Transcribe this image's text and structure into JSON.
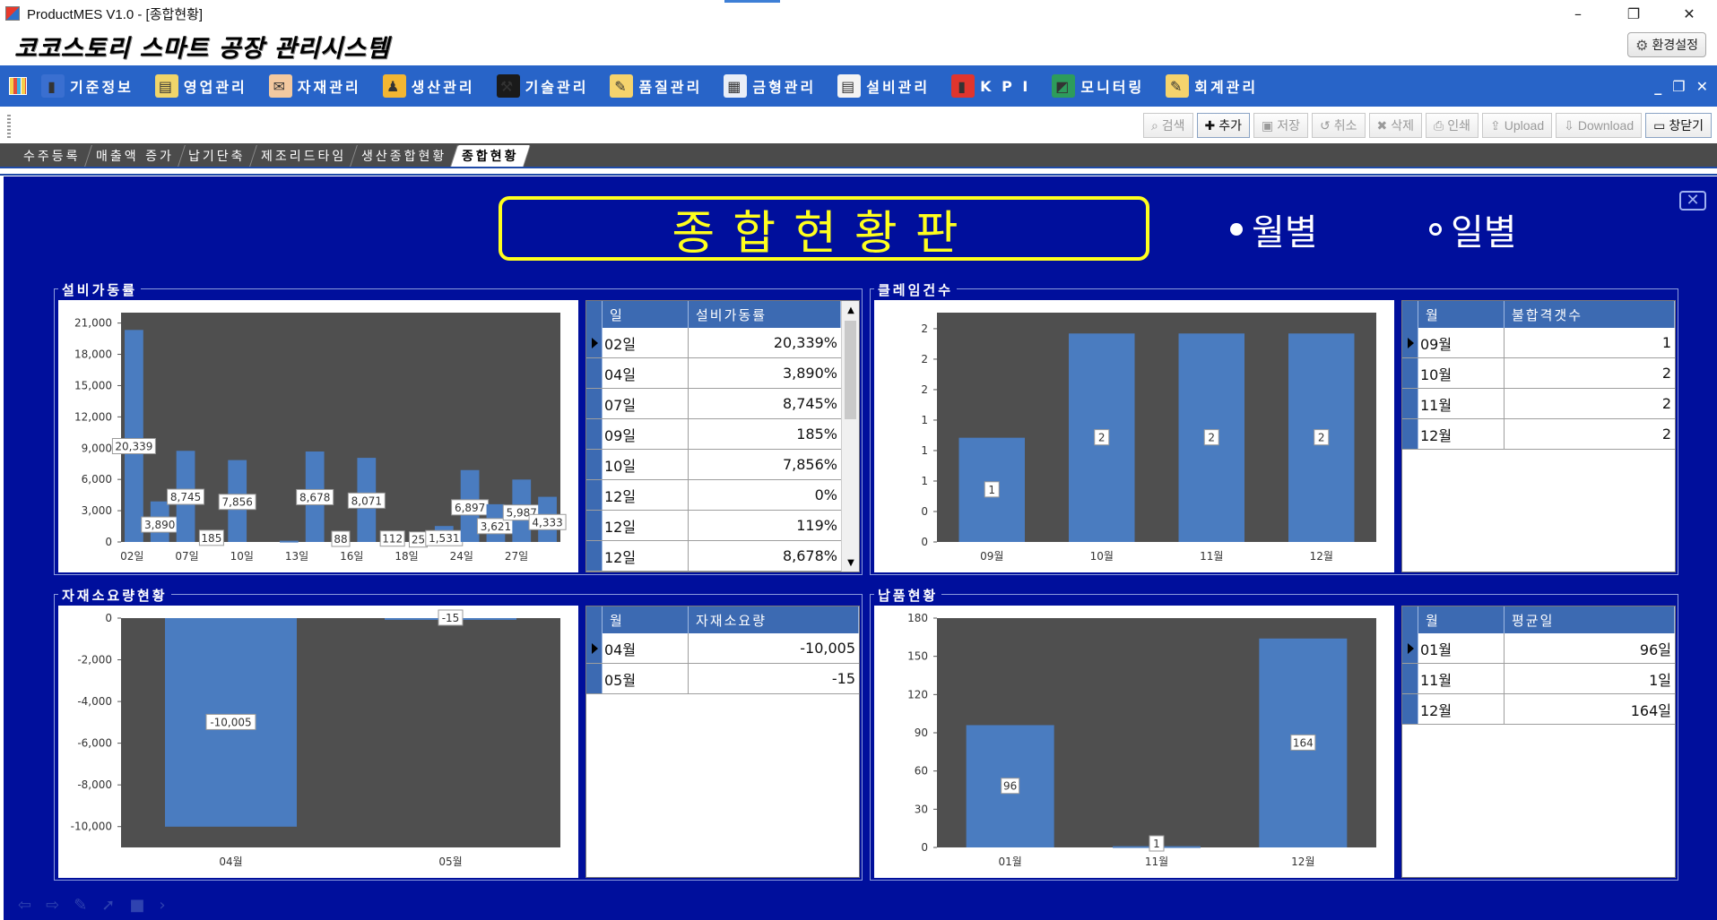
{
  "window": {
    "title": "ProductMES V1.0 - [종합현황]",
    "minimize": "–",
    "maximize": "❐",
    "close": "✕"
  },
  "app": {
    "name": "코코스토리 스마트 공장 관리시스템",
    "settings_label": "환경설정",
    "settings_icon": "gear-icon"
  },
  "menu": {
    "items": [
      {
        "label": "기준정보",
        "icon": "book-icon",
        "color": "#3a6fd0"
      },
      {
        "label": "영업관리",
        "icon": "clipboard-icon",
        "color": "#f0d56a"
      },
      {
        "label": "자재관리",
        "icon": "inbox-icon",
        "color": "#f3c9a0"
      },
      {
        "label": "생산관리",
        "icon": "workers-icon",
        "color": "#f2b632"
      },
      {
        "label": "기술관리",
        "icon": "tools-icon",
        "color": "#1a1a1a"
      },
      {
        "label": "품질관리",
        "icon": "notepad-icon",
        "color": "#f5d36d"
      },
      {
        "label": "금형관리",
        "icon": "calculator-icon",
        "color": "#e9eef7"
      },
      {
        "label": "설비관리",
        "icon": "document-icon",
        "color": "#f3f3f3"
      },
      {
        "label": "K P I",
        "icon": "bar-chart-icon",
        "color": "#e0352d"
      },
      {
        "label": "모니터링",
        "icon": "monitor-icon",
        "color": "#2d9c5b"
      },
      {
        "label": "회계관리",
        "icon": "notepad-icon",
        "color": "#f5d36d"
      }
    ],
    "win_controls": [
      "_",
      "❐",
      "✕"
    ]
  },
  "toolbar": {
    "buttons": [
      {
        "label": "검색",
        "icon": "search-icon"
      },
      {
        "label": "추가",
        "icon": "add-icon",
        "active": true
      },
      {
        "label": "저장",
        "icon": "save-icon"
      },
      {
        "label": "취소",
        "icon": "undo-icon"
      },
      {
        "label": "삭제",
        "icon": "delete-icon"
      },
      {
        "label": "인쇄",
        "icon": "print-icon"
      },
      {
        "label": "Upload",
        "icon": "upload-icon"
      },
      {
        "label": "Download",
        "icon": "download-icon"
      },
      {
        "label": "창닫기",
        "icon": "close-window-icon",
        "active": true
      }
    ]
  },
  "tabs": [
    "수주등록",
    "매출액 증가",
    "납기단축",
    "제조리드타임",
    "생산종합현황",
    "종합현황"
  ],
  "active_tab": 5,
  "board": {
    "title": "종합현황판",
    "radio_monthly": "월별",
    "radio_daily": "일별",
    "close_icon": "close-box-icon"
  },
  "panels": {
    "equipment": {
      "label": "설비가동률",
      "grid": {
        "headers": [
          "일",
          "설비가동률"
        ],
        "rows": [
          [
            "02일",
            "20,339%"
          ],
          [
            "04일",
            "3,890%"
          ],
          [
            "07일",
            "8,745%"
          ],
          [
            "09일",
            "185%"
          ],
          [
            "10일",
            "7,856%"
          ],
          [
            "12일",
            "0%"
          ],
          [
            "12일",
            "119%"
          ],
          [
            "12일",
            "8,678%"
          ]
        ]
      }
    },
    "claims": {
      "label": "클레임건수",
      "grid": {
        "headers": [
          "월",
          "불합격갯수"
        ],
        "rows": [
          [
            "09월",
            "1"
          ],
          [
            "10월",
            "2"
          ],
          [
            "11월",
            "2"
          ],
          [
            "12월",
            "2"
          ]
        ]
      }
    },
    "material": {
      "label": "자재소요량현황",
      "grid": {
        "headers": [
          "월",
          "자재소요량"
        ],
        "rows": [
          [
            "04월",
            "-10,005"
          ],
          [
            "05월",
            "-15"
          ]
        ]
      }
    },
    "delivery": {
      "label": "납품현황",
      "grid": {
        "headers": [
          "월",
          "평균일"
        ],
        "rows": [
          [
            "01월",
            "96일"
          ],
          [
            "11월",
            "1일"
          ],
          [
            "12월",
            "164일"
          ]
        ]
      }
    }
  },
  "chart_data": [
    {
      "type": "bar",
      "categories": [
        "02일",
        "04일",
        "07일",
        "09일",
        "10일",
        "12일",
        "12일",
        "12일",
        "13일",
        "16일",
        "16일",
        "18일",
        "18일",
        "24일",
        "24일",
        "24일",
        "27일"
      ],
      "values": [
        20339,
        3890,
        8745,
        185,
        7856,
        0,
        119,
        8678,
        88,
        8071,
        112,
        25,
        1531,
        6897,
        3621,
        5987,
        4333
      ],
      "data_labels": [
        "20,339",
        "3,890",
        "8,745",
        "185",
        "7,856",
        "",
        "",
        "8,678",
        "88",
        "8,071",
        "112",
        "25",
        "1,531",
        "6,897",
        "3,621",
        "5,987",
        "4,333"
      ],
      "x_tick_labels": [
        "02일",
        "07일",
        "10일",
        "13일",
        "16일",
        "18일",
        "24일",
        "27일"
      ],
      "y_ticks": [
        "0",
        "3,000",
        "6,000",
        "9,000",
        "12,000",
        "15,000",
        "18,000",
        "21,000"
      ],
      "ylim": [
        0,
        22000
      ],
      "bar_color": "#4a7cc0",
      "plot_bg": "#4f4f4f"
    },
    {
      "type": "bar",
      "categories": [
        "09월",
        "10월",
        "11월",
        "12월"
      ],
      "values": [
        1,
        2,
        2,
        2
      ],
      "data_labels": [
        "1",
        "2",
        "2",
        "2"
      ],
      "y_ticks": [
        "0",
        "0",
        "1",
        "1",
        "1",
        "2",
        "2",
        "2"
      ],
      "ylim": [
        0,
        2.2
      ],
      "bar_color": "#4a7cc0",
      "plot_bg": "#4f4f4f"
    },
    {
      "type": "bar",
      "categories": [
        "04월",
        "05월"
      ],
      "values": [
        -10005,
        -15
      ],
      "data_labels": [
        "-10,005",
        "-15"
      ],
      "y_ticks": [
        "0",
        "-2,000",
        "-4,000",
        "-6,000",
        "-8,000",
        "-10,000"
      ],
      "ylim": [
        -11000,
        0
      ],
      "bar_color": "#4a7cc0",
      "plot_bg": "#4f4f4f"
    },
    {
      "type": "bar",
      "categories": [
        "01월",
        "11월",
        "12월"
      ],
      "values": [
        96,
        1,
        164
      ],
      "data_labels": [
        "96",
        "1",
        "164"
      ],
      "y_ticks": [
        "0",
        "30",
        "60",
        "90",
        "120",
        "150",
        "180"
      ],
      "ylim": [
        0,
        180
      ],
      "bar_color": "#4a7cc0",
      "plot_bg": "#4f4f4f"
    }
  ]
}
